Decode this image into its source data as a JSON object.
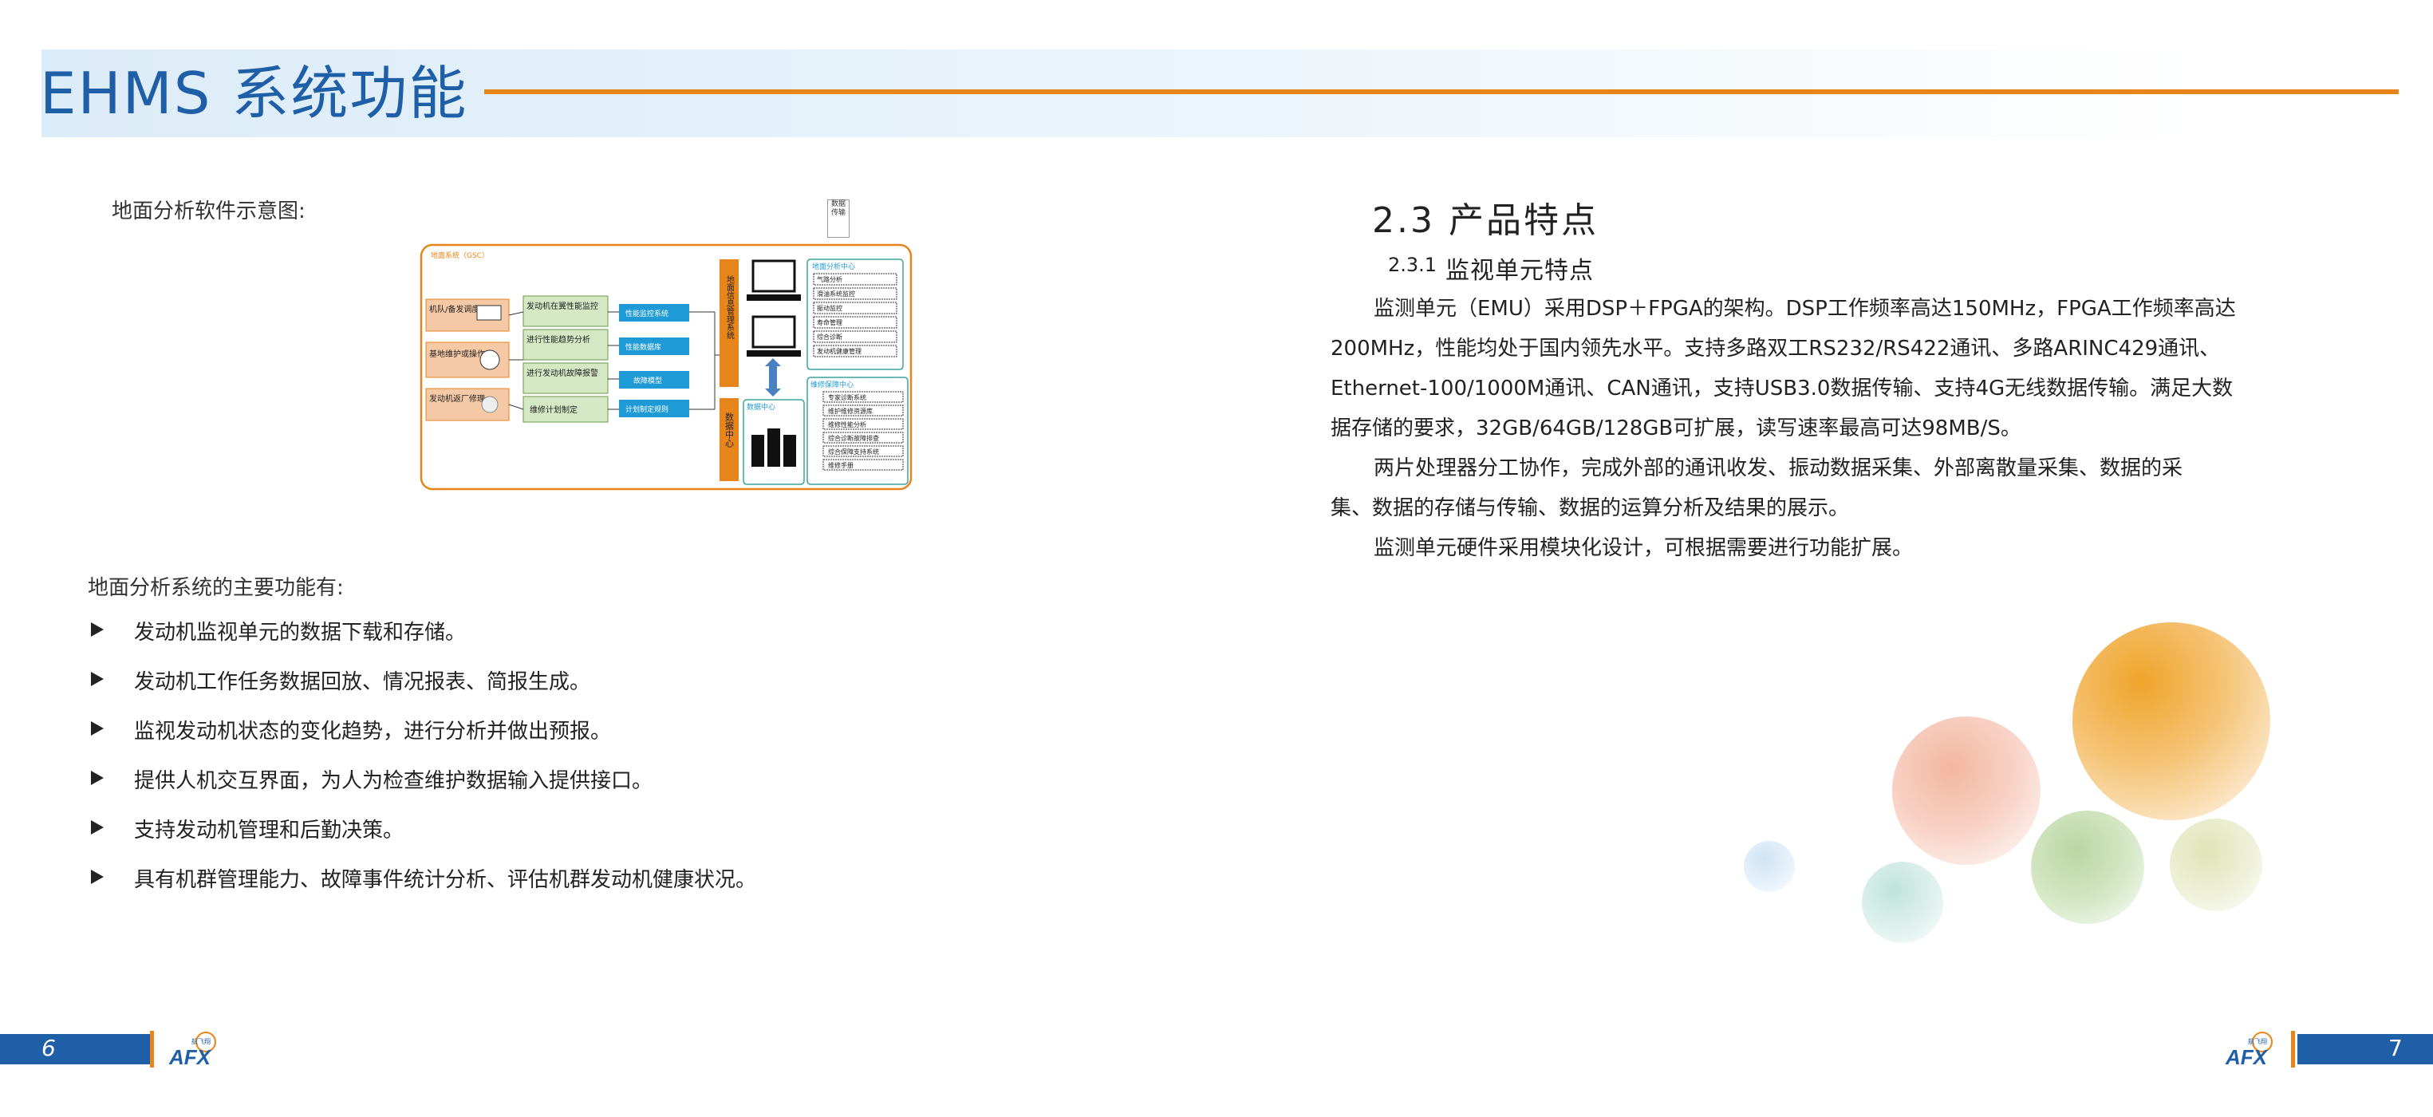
{
  "header": {
    "title": "EHMS 系统功能"
  },
  "left": {
    "diagram_caption": "地面分析软件示意图:",
    "diagram": {
      "outer_label": "地面系统（GSC）",
      "left_boxes": [
        "机队/备发调度",
        "基地维护或操作",
        "发动机返厂修理"
      ],
      "func_boxes": [
        "发动机在翼性能监控",
        "进行性能趋势分析",
        "进行发动机故障报警",
        "维修计划制定"
      ],
      "blue_boxes": [
        "性能监控系统",
        "性能数据库",
        "故障模型",
        "计划制定规则"
      ],
      "mgmt_label": "地面信息管理系统",
      "data_label": "数据中心",
      "top_right_title": "地面分析中心",
      "top_right_items": [
        "气路分析",
        "滑油系统监控",
        "振动监控",
        "寿命管理",
        "综合诊断",
        "发动机健康管理"
      ],
      "bottom_right_title": "维修保障中心",
      "bottom_right_items": [
        "专家诊断系统",
        "维护维修资源库",
        "维修性能分析",
        "综合诊断故障排查",
        "综合保障支持系统",
        "维修手册"
      ],
      "db_label": "数据中心",
      "input_label": "数据传输"
    },
    "functions_intro": "地面分析系统的主要功能有:",
    "functions": [
      "发动机监视单元的数据下载和存储。",
      "发动机工作任务数据回放、情况报表、简报生成。",
      "监视发动机状态的变化趋势，进行分析并做出预报。",
      "提供人机交互界面，为人为检查维护数据输入提供接口。",
      "支持发动机管理和后勤决策。",
      "具有机群管理能力、故障事件统计分析、评估机群发动机健康状况。"
    ]
  },
  "right": {
    "section_title": "2.3  产品特点",
    "sub_title_num": "2.3.1",
    "sub_title": "监视单元特点",
    "para1": [
      "监测单元（EMU）采用DSP＋FPGA的架构。DSP工作频率高达150MHz，FPGA工作频率高达",
      "200MHz，性能均处于国内领先水平。支持多路双工RS232/RS422通讯、多路ARINC429通讯、",
      "Ethernet-100/1000M通讯、CAN通讯，支持USB3.0数据传输、支持4G无线数据传输。满足大数",
      "据存储的要求，32GB/64GB/128GB可扩展，读写速率最高可达98MB/S。"
    ],
    "para2": [
      "两片处理器分工协作，完成外部的通讯收发、振动数据采集、外部离散量采集、数据的采",
      "集、数据的存储与传输、数据的运算分析及结果的展示。"
    ],
    "para3": "监测单元硬件采用模块化设计，可根据需要进行功能扩展。"
  },
  "footer": {
    "page_left": "6",
    "page_right": "7",
    "logo_text": "AFX",
    "logo_sub": "航飞翔"
  },
  "colors": {
    "brand_blue": "#1f5fa8",
    "accent_orange": "#e8851a"
  }
}
